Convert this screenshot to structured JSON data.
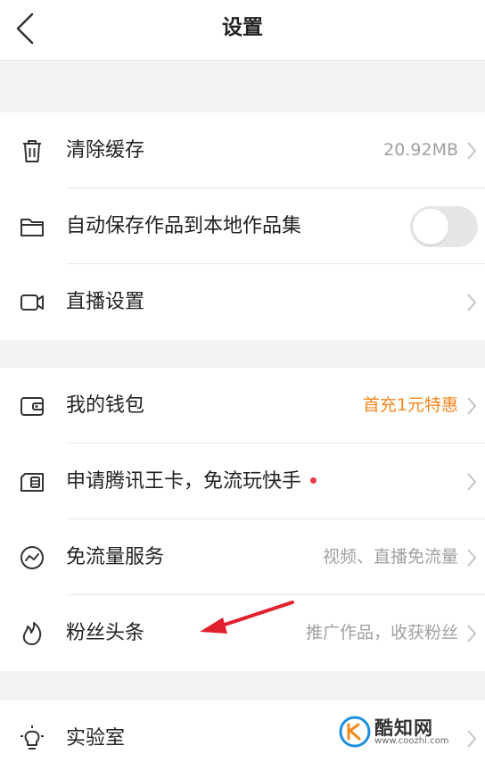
{
  "header": {
    "title": "设置"
  },
  "groups": [
    {
      "items": [
        {
          "label": "清除缓存",
          "value": "20.92MB",
          "icon": "trash-icon"
        },
        {
          "label": "自动保存作品到本地作品集",
          "toggle": false,
          "icon": "folder-icon"
        },
        {
          "label": "直播设置",
          "icon": "video-camera-icon"
        }
      ]
    },
    {
      "items": [
        {
          "label": "我的钱包",
          "value": "首充1元特惠",
          "value_color": "#f5871f",
          "icon": "wallet-icon"
        },
        {
          "label": "申请腾讯王卡，免流玩快手",
          "badge": "red-dot",
          "icon": "sim-card-icon"
        },
        {
          "label": "免流量服务",
          "value": "视频、直播免流量",
          "icon": "trend-icon"
        },
        {
          "label": "粉丝头条",
          "value": "推广作品，收获粉丝",
          "icon": "flame-icon"
        }
      ]
    },
    {
      "items": [
        {
          "label": "实验室",
          "icon": "lightbulb-icon"
        }
      ]
    }
  ],
  "watermark": {
    "title": "酷知网",
    "url": "www.coozhi.com"
  },
  "colors": {
    "accent": "#f5871f",
    "dot": "#f0394b",
    "arrow": "#e0202a"
  }
}
